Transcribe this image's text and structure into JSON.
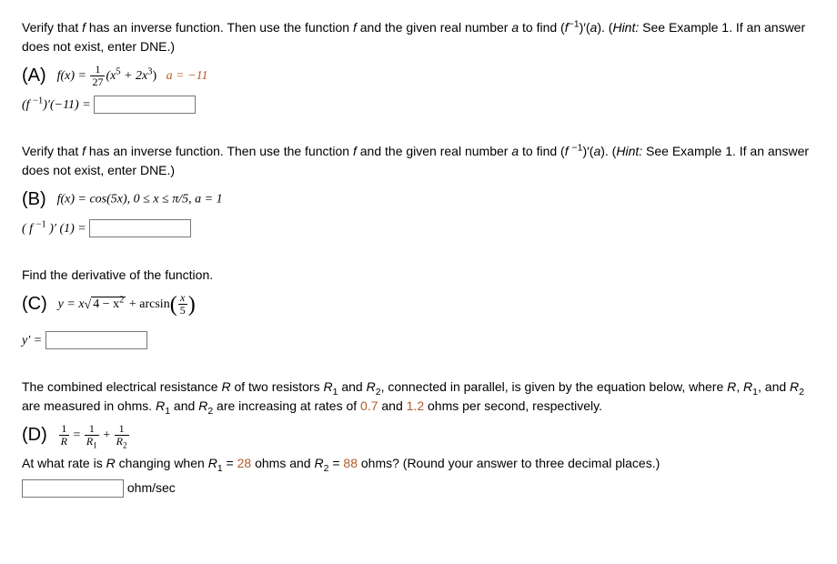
{
  "A": {
    "intro_1": "Verify that ",
    "intro_2": " has an inverse function. Then use the function ",
    "intro_3": " and the given real number ",
    "intro_4": " to find (",
    "intro_5": ")′(",
    "intro_6": "). (",
    "hint": "Hint:",
    "intro_7": " See Example 1. If an answer does not exist, enter DNE.)",
    "label": "(A)",
    "fx_prefix": "f(x) = ",
    "frac_num": "1",
    "frac_den": "27",
    "after_frac": "(x",
    "exp1": "5",
    "plus": " + 2x",
    "exp2": "3",
    "close": ")",
    "a_eq": "a = −11",
    "answer_prefix": "(f ",
    "answer_exp": "−1",
    "answer_mid": ")′(−11) = "
  },
  "B": {
    "intro_1": "Verify that ",
    "intro_2": " has an inverse function. Then use the function ",
    "intro_3": " and the given real number ",
    "intro_4": " to find (",
    "intro_5": ")′(",
    "intro_6": "). (",
    "hint": "Hint:",
    "intro_7": " See Example 1. If an answer does not exist, enter DNE.)",
    "label": "(B)",
    "fx": "f(x) = cos(5x),    0 ≤ x ≤ π/5, a = 1",
    "answer_prefix": "( f ",
    "answer_exp": "−1",
    "answer_mid": " )′ (1) = "
  },
  "C": {
    "intro": "Find the derivative of the function.",
    "label": "(C)",
    "y_eq": "y = x",
    "sqrt_in": "4 − x",
    "sqrt_exp": "2",
    "plus_arcsin": " + arcsin",
    "frac_num": "x",
    "frac_den": "5",
    "yprime": "y′ = "
  },
  "D": {
    "intro_1": "The combined electrical resistance ",
    "intro_2": " of two resistors ",
    "intro_3": " and ",
    "intro_4": ", connected in parallel, is given by the equation below, where ",
    "intro_5": ", ",
    "intro_6": ", and ",
    "intro_7": " are measured in ohms. ",
    "intro_8": " and ",
    "intro_9": " are increasing at rates of ",
    "rate1": "0.7",
    "intro_10": " and ",
    "rate2": "1.2",
    "intro_11": " ohms per second, respectively.",
    "label": "(D)",
    "eq_mid": " = ",
    "plus": " + ",
    "question_1": "At what rate is ",
    "question_2": " changing when ",
    "question_3": " = ",
    "val1": "28",
    "question_4": " ohms and ",
    "question_5": " = ",
    "val2": "88",
    "question_6": " ohms? (Round your answer to three decimal places.)",
    "unit": " ohm/sec",
    "R": "R",
    "R1": "R",
    "R2": "R",
    "one": "1",
    "two": "2"
  }
}
